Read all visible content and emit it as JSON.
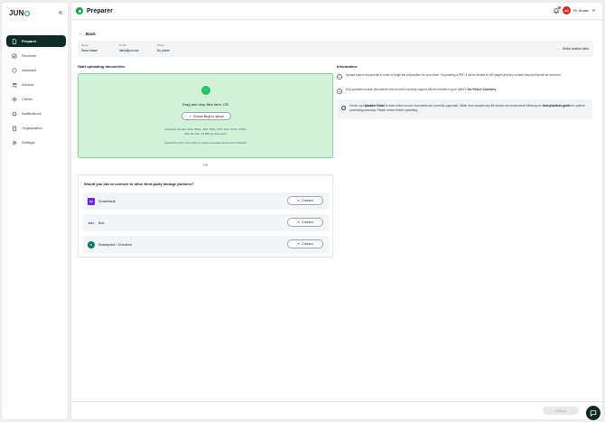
{
  "app": {
    "logo": "JUN"
  },
  "sidebar": {
    "collapse_icon": "double-chevron-left-icon",
    "items": [
      {
        "label": "Preparer",
        "icon": "document-icon",
        "active": true
      },
      {
        "label": "Reviewer",
        "icon": "review-icon"
      },
      {
        "label": "Assistant",
        "icon": "chat-icon"
      },
      {
        "label": "Advisor",
        "icon": "people-icon"
      },
      {
        "label": "Clients",
        "icon": "clients-icon"
      },
      {
        "label": "Notifications",
        "icon": "bell-icon"
      },
      {
        "label": "Organization",
        "icon": "building-icon"
      },
      {
        "label": "Settings",
        "icon": "gear-icon"
      }
    ]
  },
  "header": {
    "title": "Preparer",
    "notification_count": "1",
    "avatar_initials": "AO",
    "greeting": "Hi, Alvaar"
  },
  "back_label": "Back",
  "client": {
    "name_label": "Name",
    "name": "Dana Haase",
    "email_label": "Email",
    "email": "dana@juno.tax",
    "phone_label": "Phone",
    "phone": "No phone",
    "select_label": "Select another client"
  },
  "upload": {
    "title": "Start uploading documents:",
    "drag_text": "Drag and drop files here, OR",
    "choose_button": "Choose file(s) to upload",
    "formats": "Accepted formats: PDF, JPEG, JPG, PNG, CSV, XLS, XLSX, HTML",
    "max_size": "Max file size: 25 MB per document",
    "prior_year": "Upload the Prior Year 1040 to create a bespoke Document Checklist"
  },
  "or_text": "OR",
  "partners": {
    "title": "Would you like to connect to other third-party storage partners?",
    "connect_label": "Connect",
    "items": [
      {
        "name": "SmartVault",
        "logo_color": "#6d28d9",
        "logo_text": "SV"
      },
      {
        "name": "Box",
        "logo_color": "#0061d5",
        "logo_text": "box"
      },
      {
        "name": "Sharepoint / Onedrive",
        "logo_color": "#0f766e",
        "logo_text": "S"
      }
    ]
  },
  "information": {
    "title": "Information:",
    "item1_num": "1",
    "item1": "Upload source documents in order to begin tax preparation for your client. If uploading a PDF, it will be limited to 250 pages and any content beyond that will be removed.",
    "item2_num": "2",
    "item2_prefix": "Any uploaded source documents that we don't currently support will be included in your client's ",
    "item2_link": "Tax Return Summary.",
    "note_prefix": "Check our ",
    "note_link1": "Uploader Guide",
    "note_mid": " to learn which source documents are currently supported. While Juno accepts any file format, we recommend following our ",
    "note_link2": "best practices guide",
    "note_suffix": " for optimal processing accuracy. Please review before uploading."
  },
  "footer": {
    "continue_label": "Continue"
  },
  "colors": {
    "accent": "#16a34a",
    "dark": "#0f2b26",
    "dropzone": "#d1f2d9",
    "avatar": "#dc2626"
  }
}
